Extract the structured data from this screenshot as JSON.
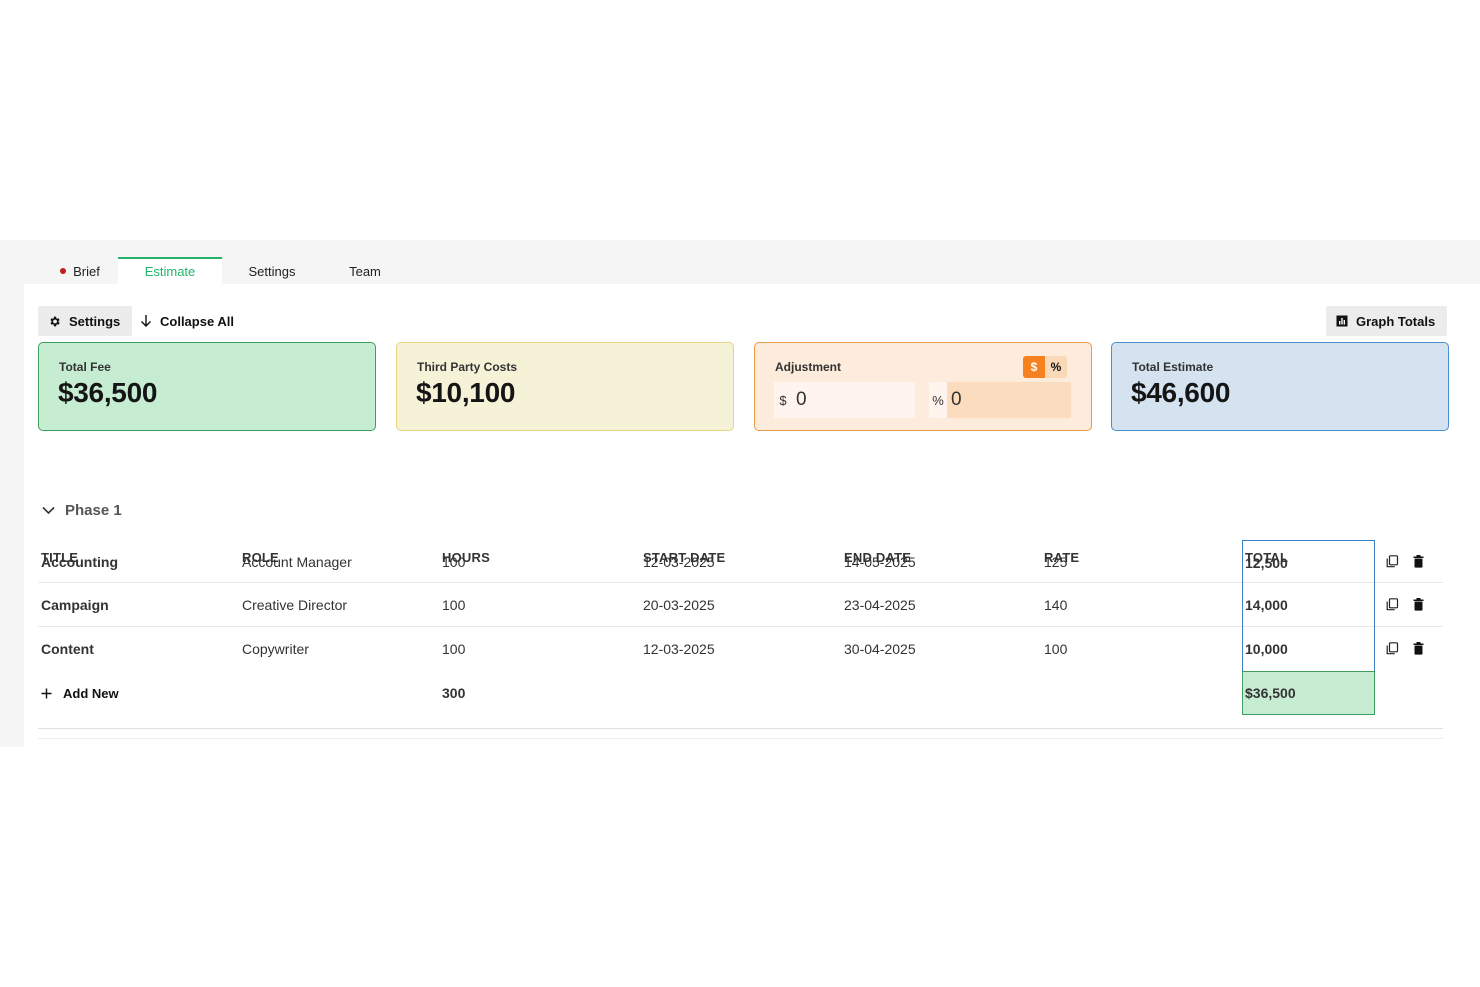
{
  "tabs": [
    {
      "label": "Brief",
      "has_dot": true,
      "dot_color": "#c0221b"
    },
    {
      "label": "Estimate",
      "active": true
    },
    {
      "label": "Settings"
    },
    {
      "label": "Team"
    }
  ],
  "toolbar": {
    "settings_label": "Settings",
    "collapse_label": "Collapse All",
    "graph_label": "Graph Totals"
  },
  "cards": {
    "total_fee": {
      "label": "Total Fee",
      "value": "$36,500"
    },
    "third_party": {
      "label": "Third Party Costs",
      "value": "$10,100"
    },
    "adjustment": {
      "label": "Adjustment",
      "toggle_dollar": "$",
      "toggle_percent": "%",
      "dollar_prefix": "$",
      "dollar_value": "0",
      "percent_prefix": "%",
      "percent_value": "0"
    },
    "total_estimate": {
      "label": "Total Estimate",
      "value": "$46,600"
    }
  },
  "phase": {
    "title": "Phase 1"
  },
  "table": {
    "headers": [
      "TITLE",
      "ROLE",
      "HOURS",
      "START DATE",
      "END DATE",
      "RATE",
      "TOTAL"
    ],
    "rows": [
      {
        "title": "Accounting",
        "role": "Account Manager",
        "hours": "100",
        "start": "12-03-2025",
        "end": "14-05-2025",
        "rate": "125",
        "total": "12,500"
      },
      {
        "title": "Campaign",
        "role": "Creative Director",
        "hours": "100",
        "start": "20-03-2025",
        "end": "23-04-2025",
        "rate": "140",
        "total": "14,000"
      },
      {
        "title": "Content",
        "role": "Copywriter",
        "hours": "100",
        "start": "12-03-2025",
        "end": "30-04-2025",
        "rate": "100",
        "total": "10,000"
      }
    ],
    "add_new_label": "Add New",
    "hours_total": "300",
    "grand_total": "$36,500"
  },
  "colors": {
    "accent_green": "#22b568",
    "fee_bg": "#c6ecd2",
    "third_party_bg": "#f6f2d8",
    "adjustment_bg": "#fdebdb",
    "estimate_bg": "#d4e3ef",
    "toggle_active": "#f5821f",
    "total_highlight": "#c6ecd2"
  }
}
